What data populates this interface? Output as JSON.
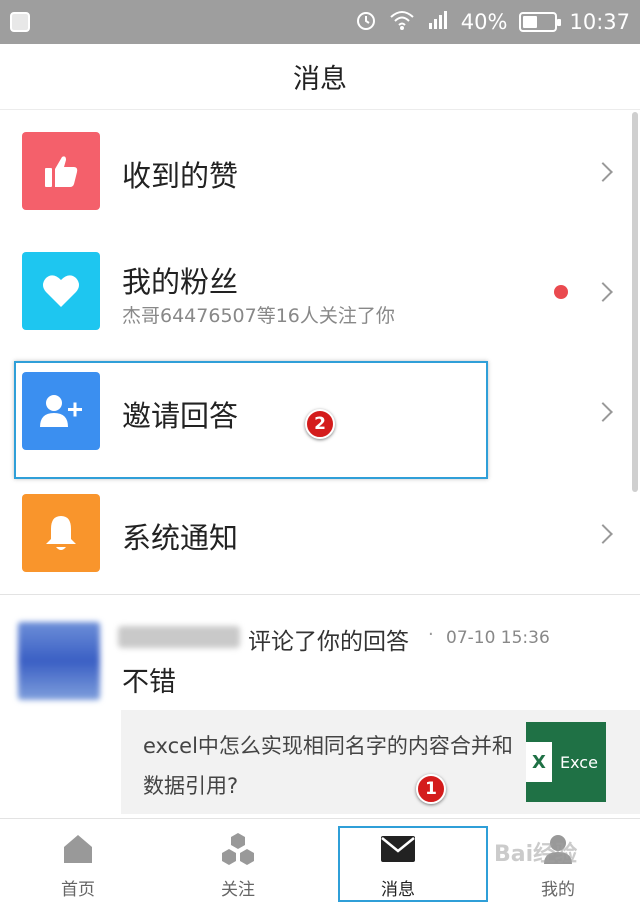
{
  "status_bar": {
    "battery": "40%",
    "time": "10:37"
  },
  "header": {
    "title": "消息"
  },
  "menu": [
    {
      "label": "收到的赞",
      "icon": "thumbs-up-icon",
      "color": "#f4606b"
    },
    {
      "label": "我的粉丝",
      "subtitle": "杰哥64476507等16人关注了你",
      "icon": "heart-icon",
      "color": "#1ec6f0",
      "unread": true
    },
    {
      "label": "邀请回答",
      "icon": "add-user-icon",
      "color": "#3b8ff0"
    },
    {
      "label": "系统通知",
      "icon": "bell-icon",
      "color": "#f9952c"
    }
  ],
  "comment": {
    "action": "评论了你的回答",
    "dot": "·",
    "time": "07-10 15:36",
    "text": "不错",
    "quote": "excel中怎么实现相同名字的内容合并和数据引用?",
    "thumb_letter": "X",
    "thumb_text": "Exce"
  },
  "tabs": [
    {
      "label": "首页",
      "icon": "home-icon"
    },
    {
      "label": "关注",
      "icon": "follow-icon"
    },
    {
      "label": "消息",
      "icon": "mail-icon",
      "active": true
    },
    {
      "label": "我的",
      "icon": "profile-icon"
    }
  ],
  "annotations": {
    "badge_1": "1",
    "badge_2": "2"
  },
  "watermark": "Bai经验"
}
